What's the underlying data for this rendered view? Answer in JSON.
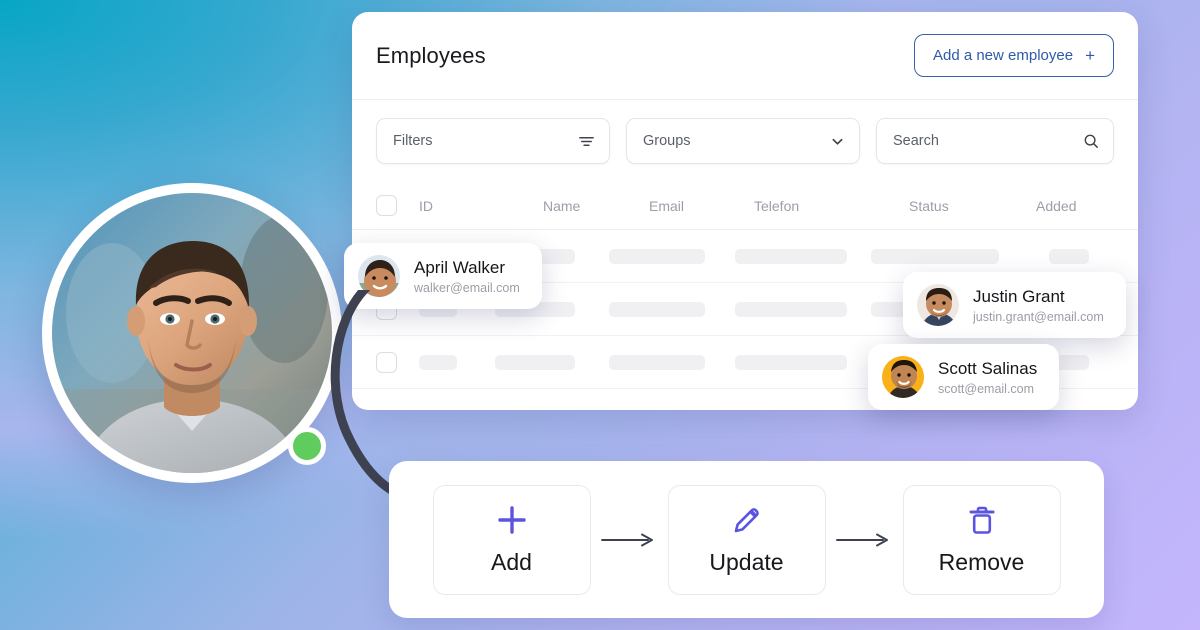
{
  "header": {
    "title": "Employees",
    "add_button_label": "Add a new employee",
    "add_button_plus": "+"
  },
  "toolbar": {
    "filters_label": "Filters",
    "filters_icon": "filter-icon",
    "groups_label": "Groups",
    "groups_icon": "chevron-down-icon",
    "search_placeholder": "Search",
    "search_icon": "search-icon"
  },
  "table": {
    "columns": [
      "ID",
      "Name",
      "Email",
      "Telefon",
      "Status",
      "Added"
    ],
    "select_all_checkbox": "unchecked",
    "skeleton_rows": [
      [
        38,
        80,
        96,
        112,
        128,
        40
      ],
      [
        38,
        80,
        96,
        112,
        128,
        40
      ],
      [
        38,
        80,
        96,
        112,
        128,
        40
      ]
    ]
  },
  "people": [
    {
      "id": "april",
      "name": "April Walker",
      "email": "walker@email.com",
      "avatar_bg": "#dfe6ef",
      "skin": "#c88a5e",
      "hair": "#2d2118"
    },
    {
      "id": "justin",
      "name": "Justin Grant",
      "email": "justin.grant@email.com",
      "avatar_bg": "#efe8e2",
      "skin": "#c68c60",
      "hair": "#2a1d14"
    },
    {
      "id": "scott",
      "name": "Scott Salinas",
      "email": "scott@email.com",
      "avatar_bg": "#f9b019",
      "skin": "#c08552",
      "hair": "#1f160f"
    }
  ],
  "portrait": {
    "alt": "employee-portrait",
    "status": "online",
    "status_color": "#5fcc5d"
  },
  "actions": [
    {
      "label": "Add",
      "icon": "plus-icon"
    },
    {
      "label": "Update",
      "icon": "pencil-icon"
    },
    {
      "label": "Remove",
      "icon": "trash-icon"
    }
  ],
  "colors": {
    "accent": "#5b54e0",
    "add_button_border": "#3a5fb0",
    "background_start": "#0aa5c4",
    "background_end": "#c4b5fd",
    "arrow": "#3d4150"
  }
}
